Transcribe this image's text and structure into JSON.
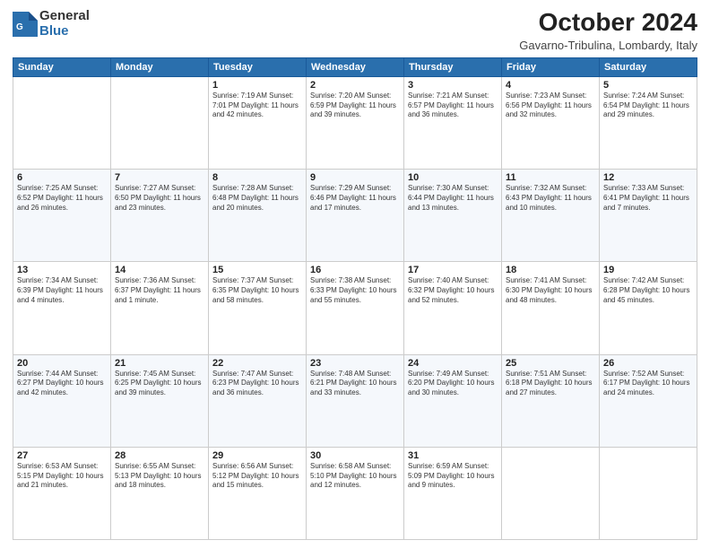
{
  "header": {
    "logo_general": "General",
    "logo_blue": "Blue",
    "month_title": "October 2024",
    "location": "Gavarno-Tribulina, Lombardy, Italy"
  },
  "weekdays": [
    "Sunday",
    "Monday",
    "Tuesday",
    "Wednesday",
    "Thursday",
    "Friday",
    "Saturday"
  ],
  "weeks": [
    [
      {
        "day": "",
        "info": ""
      },
      {
        "day": "",
        "info": ""
      },
      {
        "day": "1",
        "info": "Sunrise: 7:19 AM\nSunset: 7:01 PM\nDaylight: 11 hours and 42 minutes."
      },
      {
        "day": "2",
        "info": "Sunrise: 7:20 AM\nSunset: 6:59 PM\nDaylight: 11 hours and 39 minutes."
      },
      {
        "day": "3",
        "info": "Sunrise: 7:21 AM\nSunset: 6:57 PM\nDaylight: 11 hours and 36 minutes."
      },
      {
        "day": "4",
        "info": "Sunrise: 7:23 AM\nSunset: 6:56 PM\nDaylight: 11 hours and 32 minutes."
      },
      {
        "day": "5",
        "info": "Sunrise: 7:24 AM\nSunset: 6:54 PM\nDaylight: 11 hours and 29 minutes."
      }
    ],
    [
      {
        "day": "6",
        "info": "Sunrise: 7:25 AM\nSunset: 6:52 PM\nDaylight: 11 hours and 26 minutes."
      },
      {
        "day": "7",
        "info": "Sunrise: 7:27 AM\nSunset: 6:50 PM\nDaylight: 11 hours and 23 minutes."
      },
      {
        "day": "8",
        "info": "Sunrise: 7:28 AM\nSunset: 6:48 PM\nDaylight: 11 hours and 20 minutes."
      },
      {
        "day": "9",
        "info": "Sunrise: 7:29 AM\nSunset: 6:46 PM\nDaylight: 11 hours and 17 minutes."
      },
      {
        "day": "10",
        "info": "Sunrise: 7:30 AM\nSunset: 6:44 PM\nDaylight: 11 hours and 13 minutes."
      },
      {
        "day": "11",
        "info": "Sunrise: 7:32 AM\nSunset: 6:43 PM\nDaylight: 11 hours and 10 minutes."
      },
      {
        "day": "12",
        "info": "Sunrise: 7:33 AM\nSunset: 6:41 PM\nDaylight: 11 hours and 7 minutes."
      }
    ],
    [
      {
        "day": "13",
        "info": "Sunrise: 7:34 AM\nSunset: 6:39 PM\nDaylight: 11 hours and 4 minutes."
      },
      {
        "day": "14",
        "info": "Sunrise: 7:36 AM\nSunset: 6:37 PM\nDaylight: 11 hours and 1 minute."
      },
      {
        "day": "15",
        "info": "Sunrise: 7:37 AM\nSunset: 6:35 PM\nDaylight: 10 hours and 58 minutes."
      },
      {
        "day": "16",
        "info": "Sunrise: 7:38 AM\nSunset: 6:33 PM\nDaylight: 10 hours and 55 minutes."
      },
      {
        "day": "17",
        "info": "Sunrise: 7:40 AM\nSunset: 6:32 PM\nDaylight: 10 hours and 52 minutes."
      },
      {
        "day": "18",
        "info": "Sunrise: 7:41 AM\nSunset: 6:30 PM\nDaylight: 10 hours and 48 minutes."
      },
      {
        "day": "19",
        "info": "Sunrise: 7:42 AM\nSunset: 6:28 PM\nDaylight: 10 hours and 45 minutes."
      }
    ],
    [
      {
        "day": "20",
        "info": "Sunrise: 7:44 AM\nSunset: 6:27 PM\nDaylight: 10 hours and 42 minutes."
      },
      {
        "day": "21",
        "info": "Sunrise: 7:45 AM\nSunset: 6:25 PM\nDaylight: 10 hours and 39 minutes."
      },
      {
        "day": "22",
        "info": "Sunrise: 7:47 AM\nSunset: 6:23 PM\nDaylight: 10 hours and 36 minutes."
      },
      {
        "day": "23",
        "info": "Sunrise: 7:48 AM\nSunset: 6:21 PM\nDaylight: 10 hours and 33 minutes."
      },
      {
        "day": "24",
        "info": "Sunrise: 7:49 AM\nSunset: 6:20 PM\nDaylight: 10 hours and 30 minutes."
      },
      {
        "day": "25",
        "info": "Sunrise: 7:51 AM\nSunset: 6:18 PM\nDaylight: 10 hours and 27 minutes."
      },
      {
        "day": "26",
        "info": "Sunrise: 7:52 AM\nSunset: 6:17 PM\nDaylight: 10 hours and 24 minutes."
      }
    ],
    [
      {
        "day": "27",
        "info": "Sunrise: 6:53 AM\nSunset: 5:15 PM\nDaylight: 10 hours and 21 minutes."
      },
      {
        "day": "28",
        "info": "Sunrise: 6:55 AM\nSunset: 5:13 PM\nDaylight: 10 hours and 18 minutes."
      },
      {
        "day": "29",
        "info": "Sunrise: 6:56 AM\nSunset: 5:12 PM\nDaylight: 10 hours and 15 minutes."
      },
      {
        "day": "30",
        "info": "Sunrise: 6:58 AM\nSunset: 5:10 PM\nDaylight: 10 hours and 12 minutes."
      },
      {
        "day": "31",
        "info": "Sunrise: 6:59 AM\nSunset: 5:09 PM\nDaylight: 10 hours and 9 minutes."
      },
      {
        "day": "",
        "info": ""
      },
      {
        "day": "",
        "info": ""
      }
    ]
  ]
}
